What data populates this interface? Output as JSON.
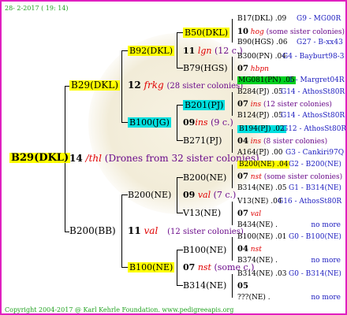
{
  "header": "28- 2-2017 ( 19: 14)",
  "footer": "Copyright 2004-2017 @ Karl Kehrle Foundation.   www.pedigreeapis.org",
  "root": {
    "label": "B29(DKL)",
    "num": "14",
    "line": "/thl",
    "note": "(Drones from 32 sister colonies)"
  },
  "g1": {
    "top": {
      "label": "B29(DKL)",
      "num": "12",
      "line": "frkg",
      "note": "(28 sister colonies)"
    },
    "bot": {
      "label": "B200(BB)",
      "num": "11",
      "line": "val",
      "note": "(12 sister colonies)"
    }
  },
  "g2": {
    "a": {
      "label": "B92(DKL)",
      "num": "11",
      "line": "lgn",
      "note": "(12 c.)"
    },
    "b": {
      "label": "B100(JG)",
      "num": "09",
      "line": "ins",
      "note": "(9 c.)"
    },
    "c": {
      "label": "B200(NE)",
      "num": "09",
      "line": "val",
      "note": "(7 c.)"
    },
    "d": {
      "label": "B100(NE)",
      "num": "07",
      "line": "nst",
      "note": "(some c.)"
    }
  },
  "g3": {
    "a": {
      "label": "B50(DKL)",
      "num": "10",
      "line": "hog",
      "note": "(some sister colonies)"
    },
    "b": {
      "label": "B79(HGS)",
      "num": "07",
      "line": "hbpn",
      "note": ""
    },
    "c": {
      "label": "B201(PJ)",
      "num": "07",
      "line": "ins",
      "note": "(12 sister colonies)"
    },
    "d": {
      "label": "B271(PJ)",
      "num": "04",
      "line": "ins",
      "note": "(8 sister colonies)"
    },
    "e": {
      "label": "B200(NE)",
      "num": "07",
      "line": "nst",
      "note": "(some sister colonies)"
    },
    "f": {
      "label": "V13(NE)",
      "num": "07",
      "line": "val",
      "note": ""
    },
    "g": {
      "label": "B100(NE)",
      "num": "04",
      "line": "nst",
      "note": ""
    },
    "h": {
      "label": "B314(NE)",
      "num": "05",
      "line": "",
      "note": ""
    }
  },
  "g4": [
    {
      "label": "B17(DKL) .09",
      "right": "G9 - MG00R"
    },
    {
      "label": "B90(HGS) .06",
      "right": "G27 - B-xx43"
    },
    {
      "label": "B300(PN) .04",
      "right": "G4 - Bayburt98-3"
    },
    {
      "label": "MG081(PN) .05",
      "right": "1 - Margret04R"
    },
    {
      "label": "B284(PJ) .05",
      "right": "G14 - AthosSt80R"
    },
    {
      "label": "B124(PJ) .05",
      "right": "G14 - AthosSt80R"
    },
    {
      "label": "B194(PJ) .02",
      "right": "G12 - AthosSt80R"
    },
    {
      "label": "A164(PJ) .00",
      "right": "G3 - Cankiri97Q"
    },
    {
      "label": "B200(NE) .04",
      "right": "G2 - B200(NE)"
    },
    {
      "label": "B314(NE) .05",
      "right": "G1 - B314(NE)"
    },
    {
      "label": "V13(NE) .04",
      "right": "G16 - AthosSt80R"
    },
    {
      "label": "B434(NE) .",
      "right": "no more"
    },
    {
      "label": "B100(NE) .01",
      "right": "G0 - B100(NE)"
    },
    {
      "label": "B374(NE) .",
      "right": "no more"
    },
    {
      "label": "B314(NE) .03",
      "right": "G0 - B314(NE)"
    },
    {
      "label": "???(NE) .",
      "right": "no more"
    }
  ],
  "colors": {
    "border": "#e020c0",
    "yellow": "#ffff00",
    "cyan": "#00e0e0",
    "green": "#00d020",
    "purple": "#6a0a8a",
    "red": "#e00000",
    "blue": "#2020c0"
  }
}
